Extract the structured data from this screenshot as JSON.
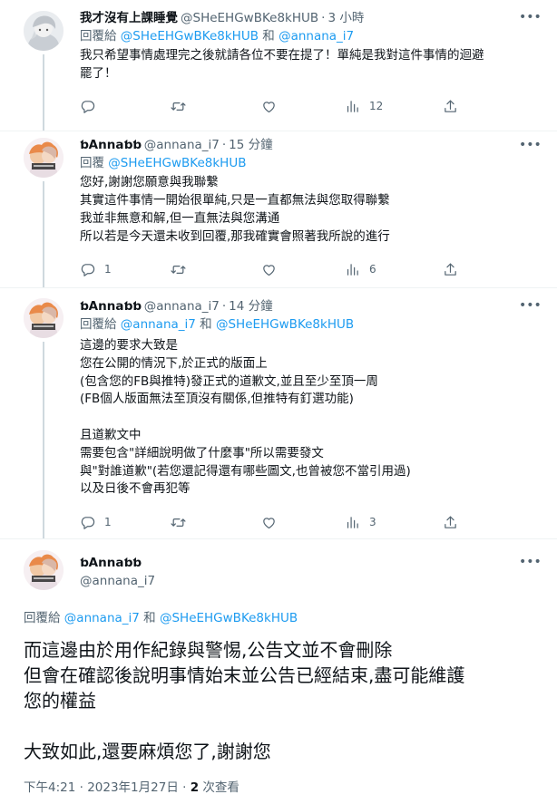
{
  "tweets": [
    {
      "name": "我才沒有上課睡覺",
      "handle": "@SHeEHGwBKe8kHUB",
      "dot": "·",
      "time": "3 小時",
      "reply_prefix": "回覆給",
      "reply_mention_1": "@SHeEHGwBKe8kHUB",
      "reply_and": "和",
      "reply_mention_2": "@annana_i7",
      "text": "我只希望事情處理完之後就請各位不要在提了！單純是我對這件事情的迴避\n罷了！",
      "replies": "",
      "retweets": "",
      "likes": "",
      "views": "12"
    },
    {
      "name": "ƅAnnaƅƅ",
      "handle": "@annana_i7",
      "dot": "·",
      "time": "15 分鐘",
      "reply_prefix": "回覆",
      "reply_mention_1": "@SHeEHGwBKe8kHUB",
      "text": "您好,謝謝您願意與我聯繫\n其實這件事情一開始很單純,只是一直都無法與您取得聯繫\n我並非無意和解,但一直無法與您溝通\n所以若是今天還未收到回覆,那我確實會照著我所說的進行",
      "replies": "1",
      "retweets": "",
      "likes": "",
      "views": "6"
    },
    {
      "name": "ƅAnnaƅƅ",
      "handle": "@annana_i7",
      "dot": "·",
      "time": "14 分鐘",
      "reply_prefix": "回覆給",
      "reply_mention_1": "@annana_i7",
      "reply_and": "和",
      "reply_mention_2": "@SHeEHGwBKe8kHUB",
      "text": "這邊的要求大致是\n您在公開的情況下,於正式的版面上\n(包含您的FB與推特)發正式的道歉文,並且至少至頂一周\n(FB個人版面無法至頂沒有關係,但推特有釘選功能)\n\n且道歉文中\n需要包含\"詳細說明做了什麼事\"所以需要發文\n與\"對誰道歉\"(若您還記得還有哪些圖文,也曾被您不當引用過)\n以及日後不會再犯等",
      "replies": "1",
      "retweets": "",
      "likes": "",
      "views": "3"
    }
  ],
  "main_tweet": {
    "name": "ƅAnnaƅƅ",
    "handle": "@annana_i7",
    "reply_prefix": "回覆給",
    "reply_mention_1": "@annana_i7",
    "reply_and": "和",
    "reply_mention_2": "@SHeEHGwBKe8kHUB",
    "text": "而這邊由於用作紀錄與警惕,公告文並不會刪除\n但會在確認後說明事情始末並公告已經結束,盡可能維護\n您的權益\n\n大致如此,還要麻煩您了,謝謝您",
    "time": "下午4:21 · 2023年1月27日",
    "dot": "·",
    "view_count": "2",
    "view_label": "次查看"
  },
  "icons": {
    "reply": "reply-icon",
    "retweet": "retweet-icon",
    "like": "like-icon",
    "views": "views-icon",
    "share": "share-icon",
    "more": "more-icon"
  },
  "colors": {
    "accent": "#1d9bf0",
    "secondary_text": "#536471",
    "divider": "#eff3f4"
  }
}
